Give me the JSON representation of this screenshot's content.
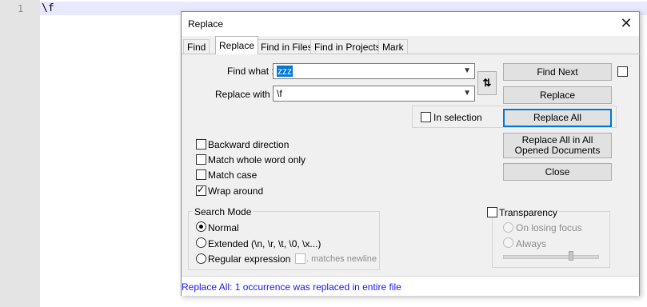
{
  "editor": {
    "line_number": "1",
    "line_text": "\\f"
  },
  "dialog": {
    "title": "Replace",
    "close_glyph": "✕",
    "tabs": [
      {
        "label": "Find",
        "active": false
      },
      {
        "label": "Replace",
        "active": true
      },
      {
        "label": "Find in Files",
        "active": false
      },
      {
        "label": "Find in Projects",
        "active": false
      },
      {
        "label": "Mark",
        "active": false
      }
    ],
    "find_what_label": "Find what :",
    "find_what_value": "zzz",
    "replace_with_label": "Replace with :",
    "replace_with_value": "\\f",
    "swap_icon": "⇅",
    "buttons": {
      "find_next": "Find Next",
      "replace": "Replace",
      "replace_all": "Replace All",
      "replace_all_opened": "Replace All in All Opened Documents",
      "close": "Close"
    },
    "in_selection_label": "In selection",
    "options": [
      {
        "label": "Backward direction",
        "checked": false
      },
      {
        "label": "Match whole word only",
        "checked": false
      },
      {
        "label": "Match case",
        "checked": false
      },
      {
        "label": "Wrap around",
        "checked": true
      }
    ],
    "search_mode": {
      "title": "Search Mode",
      "normal": "Normal",
      "extended": "Extended (\\n, \\r, \\t, \\0, \\x...)",
      "regex": "Regular expression",
      "matches_newline": ". matches newline",
      "selected": "normal"
    },
    "transparency": {
      "label": "Transparency",
      "on_losing_focus": "On losing focus",
      "always": "Always"
    },
    "status": "Replace All: 1 occurrence was replaced in entire file",
    "colors": {
      "status_text": "#1717ff",
      "selection": "#0078d7",
      "current_line": "#e8e8ff"
    }
  }
}
